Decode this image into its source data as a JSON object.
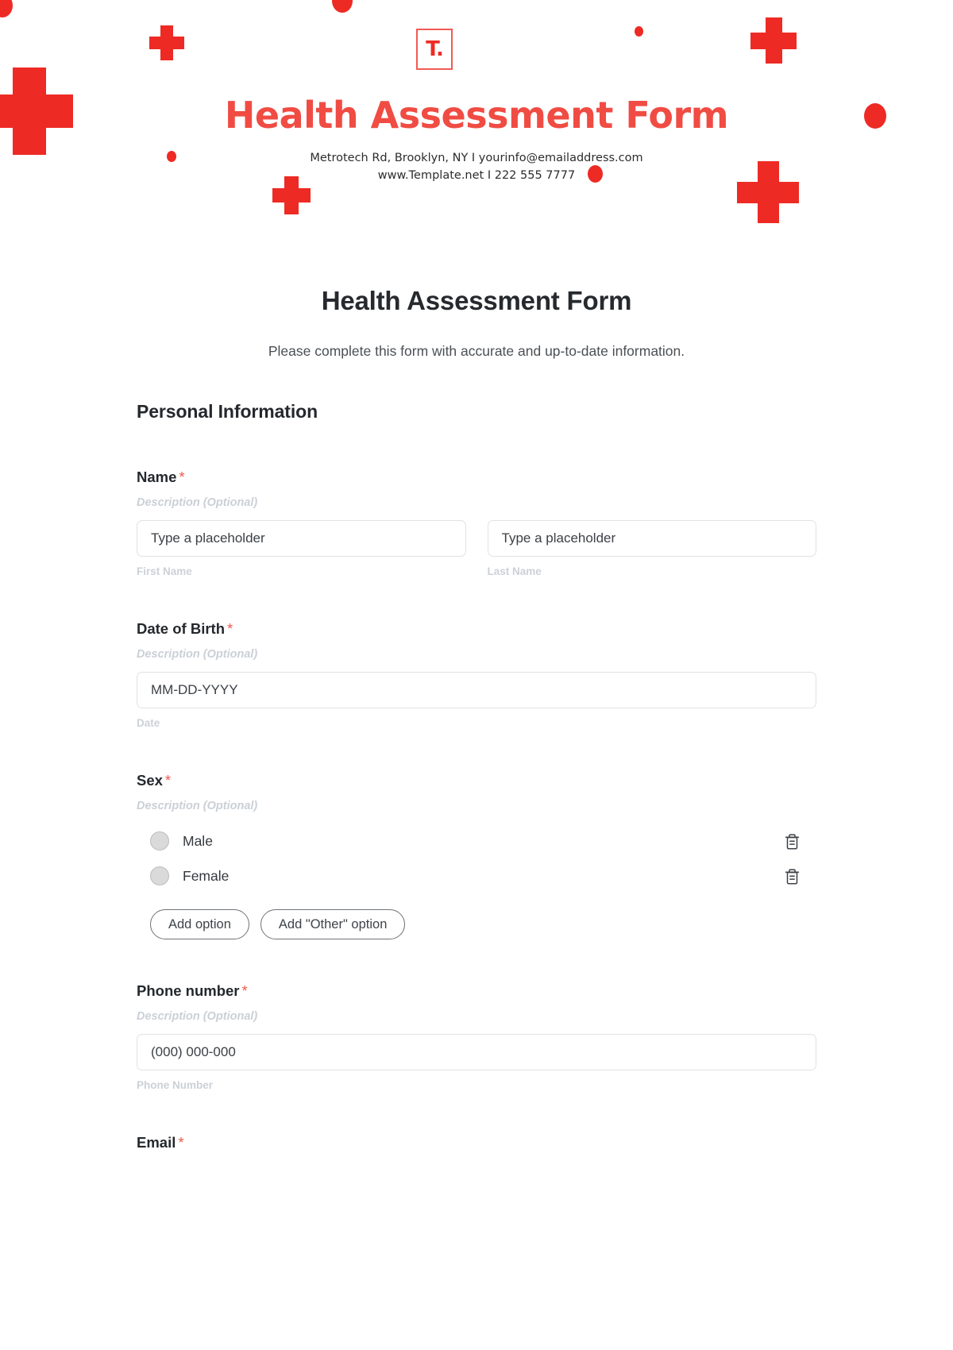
{
  "banner": {
    "logo_mark": "T.",
    "logo_icon": "template-net-logo-icon",
    "title": "Health Assessment Form",
    "contact_line1": "Metrotech Rd, Brooklyn, NY  I  yourinfo@emailaddress.com",
    "contact_line2": "www.Template.net  I  222 555 7777",
    "accent_color": "#ee2a25",
    "title_color": "#f04c43"
  },
  "form": {
    "title": "Health Assessment Form",
    "subtitle": "Please complete this form with accurate and up-to-date information.",
    "section_heading": "Personal Information",
    "required_marker": "*",
    "description_placeholder": "Description (Optional)"
  },
  "fields": {
    "name": {
      "label": "Name",
      "required": "*",
      "description": "Description (Optional)",
      "first": {
        "placeholder": "Type a placeholder",
        "value": "",
        "sub_label": "First Name"
      },
      "last": {
        "placeholder": "Type a placeholder",
        "value": "",
        "sub_label": "Last Name"
      }
    },
    "dob": {
      "label": "Date of Birth",
      "required": "*",
      "description": "Description (Optional)",
      "placeholder": "MM-DD-YYYY",
      "value": "",
      "sub_label": "Date"
    },
    "sex": {
      "label": "Sex",
      "required": "*",
      "description": "Description (Optional)",
      "options": [
        {
          "label": "Male",
          "selected": false,
          "delete_icon": "trash-icon"
        },
        {
          "label": "Female",
          "selected": false,
          "delete_icon": "trash-icon"
        }
      ],
      "add_option_label": "Add option",
      "add_other_label": "Add \"Other\" option"
    },
    "phone": {
      "label": "Phone number",
      "required": "*",
      "description": "Description (Optional)",
      "placeholder": "(000) 000-000",
      "value": "",
      "sub_label": "Phone Number"
    },
    "email": {
      "label": "Email",
      "required": "*"
    }
  }
}
